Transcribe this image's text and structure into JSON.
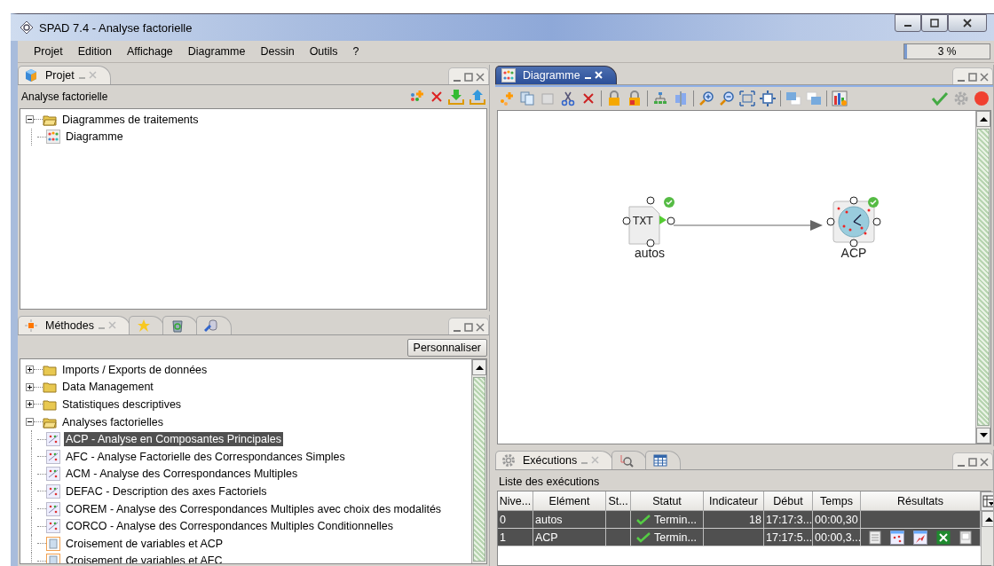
{
  "window": {
    "title": "SPAD 7.4 - Analyse factorielle"
  },
  "menu": [
    {
      "label": "Projet"
    },
    {
      "label": "Edition"
    },
    {
      "label": "Affichage"
    },
    {
      "label": "Diagramme"
    },
    {
      "label": "Dessin"
    },
    {
      "label": "Outils"
    },
    {
      "label": "?"
    }
  ],
  "progress": {
    "text": "3 %",
    "level": 0.03
  },
  "project_panel": {
    "tab": "Projet",
    "header": "Analyse factorielle",
    "tree": [
      {
        "label": "Diagrammes de traitements",
        "expanded": true,
        "children": [
          {
            "label": "Diagramme"
          }
        ]
      }
    ]
  },
  "methods_panel": {
    "tab": "Méthodes",
    "button": "Personnaliser",
    "tree": [
      {
        "label": "Imports / Exports de données",
        "expanded": false
      },
      {
        "label": "Data Management",
        "expanded": false
      },
      {
        "label": "Statistiques descriptives",
        "expanded": false
      },
      {
        "label": "Analyses factorielles",
        "expanded": true,
        "children": [
          {
            "label": "ACP - Analyse en Composantes Principales",
            "kind": "method",
            "selected": true
          },
          {
            "label": "AFC - Analyse Factorielle des Correspondances Simples",
            "kind": "method",
            "selected": false
          },
          {
            "label": "ACM - Analyse des Correspondances Multiples",
            "kind": "method",
            "selected": false
          },
          {
            "label": "DEFAC - Description des axes Factoriels",
            "kind": "method",
            "selected": false
          },
          {
            "label": "COREM - Analyse des Correspondances Multiples avec choix des modalités",
            "kind": "method",
            "selected": false
          },
          {
            "label": "CORCO - Analyse des Correspondances Multiples Conditionnelles",
            "kind": "method",
            "selected": false
          },
          {
            "label": "Croisement de variables et ACP",
            "kind": "crossing",
            "selected": false
          },
          {
            "label": "Croisement de variables et AFC",
            "kind": "crossing",
            "selected": false
          }
        ]
      }
    ]
  },
  "diagram_panel": {
    "tab": "Diagramme",
    "nodes": [
      {
        "label": "autos",
        "kind": "file",
        "badge": "TXT",
        "completed": true
      },
      {
        "label": "ACP",
        "kind": "pca",
        "completed": true
      }
    ]
  },
  "executions_panel": {
    "tab": "Exécutions",
    "title": "Liste des exécutions",
    "columns": [
      "Nive...",
      "Elément",
      "St...",
      "Statut",
      "Indicateur",
      "Début",
      "Temps",
      "Résultats"
    ],
    "rows": [
      {
        "level_no": "0",
        "element": "autos",
        "status": "Termin...",
        "done": true,
        "indicator": "18",
        "start": "17:17:3...",
        "time": "00:00,30",
        "has_results": false,
        "selected": true
      },
      {
        "level_no": "1",
        "element": "ACP",
        "status": "Termin...",
        "done": true,
        "indicator": "",
        "start": "17:17:5...",
        "time": "00:00,3...",
        "has_results": true,
        "selected": true
      }
    ]
  }
}
